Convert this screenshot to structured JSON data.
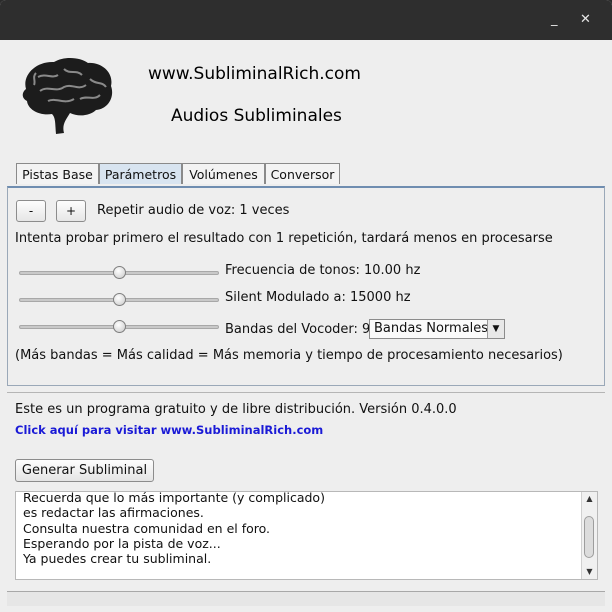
{
  "window": {
    "minimize_glyph": "_",
    "close_glyph": "✕"
  },
  "header": {
    "site": "www.SubliminalRich.com",
    "subtitle": "Audios Subliminales"
  },
  "tabs": [
    {
      "label": "Pistas Base",
      "active": false
    },
    {
      "label": "Parámetros",
      "active": true
    },
    {
      "label": "Volúmenes",
      "active": false
    },
    {
      "label": "Conversor",
      "active": false
    }
  ],
  "params": {
    "minus_label": "-",
    "plus_label": "+",
    "repeat_text": "Repetir audio de voz: 1 veces",
    "hint_text": "Intenta probar primero el resultado con 1 repetición, tardará menos en procesarse",
    "sliders": [
      {
        "label": "Frecuencia de tonos: 10.00 hz",
        "level_percent": 50
      },
      {
        "label": "Silent Modulado a: 15000 hz",
        "level_percent": 50
      },
      {
        "label": "Bandas del Vocoder: 9",
        "level_percent": 50
      }
    ],
    "vocoder_select": {
      "selected": "Bandas Normales"
    },
    "note": "(Más bandas = Más calidad = Más memoria y tiempo de procesamiento necesarios)"
  },
  "info": {
    "text": "Este es un programa gratuito y de libre distribución. Versión 0.4.0.0",
    "link": "Click aquí para visitar www.SubliminalRich.com"
  },
  "generate_button": "Generar Subliminal",
  "log": [
    "Recuerda que lo más importante (y complicado)",
    "es redactar las afirmaciones.",
    "Consulta nuestra comunidad en el foro.",
    "Esperando por la pista de voz...",
    "Ya puedes crear tu subliminal."
  ],
  "colors": {
    "link": "#1a1ad6",
    "active_tab": "#d8e4f0",
    "titlebar": "#2e2e2e"
  }
}
